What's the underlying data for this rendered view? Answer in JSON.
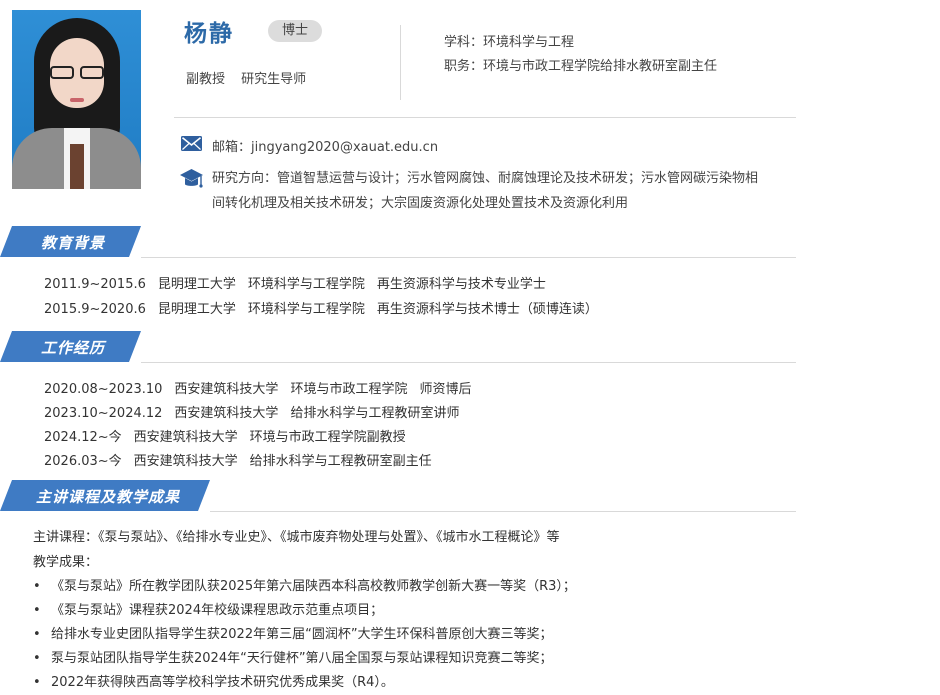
{
  "profile": {
    "name": "杨静",
    "degree": "博士",
    "titles": [
      "副教授",
      "研究生导师"
    ],
    "discipline": "学科：环境科学与工程",
    "position": "职务：环境与市政工程学院给排水教研室副主任",
    "email": "邮箱：jingyang2020@xauat.edu.cn",
    "research_line1": "研究方向：管道智慧运营与设计；污水管网腐蚀、耐腐蚀理论及技术研发；污水管网碳污染物相",
    "research_line2": "间转化机理及相关技术研发；大宗固废资源化处理处置技术及资源化利用"
  },
  "icons": {
    "mail": "mail-icon",
    "cap": "graduation-cap-icon"
  },
  "colors": {
    "accent": "#3f7bc4",
    "name": "#2d6aa8"
  },
  "education": {
    "title": "教育背景",
    "rows": [
      [
        "2011.9~2015.6",
        "昆明理工大学",
        "环境科学与工程学院",
        "再生资源科学与技术专业学士"
      ],
      [
        "2015.9~2020.6",
        "昆明理工大学",
        "环境科学与工程学院",
        "再生资源科学与技术博士（硕博连读）"
      ]
    ]
  },
  "work": {
    "title": "工作经历",
    "rows": [
      [
        "2020.08~2023.10",
        "西安建筑科技大学",
        "环境与市政工程学院",
        "师资博后"
      ],
      [
        "2023.10~2024.12",
        "西安建筑科技大学",
        "给排水科学与工程教研室讲师"
      ],
      [
        "2024.12~今",
        "西安建筑科技大学",
        "环境与市政工程学院副教授"
      ],
      [
        "2026.03~今",
        "西安建筑科技大学",
        "给排水科学与工程教研室副主任"
      ]
    ]
  },
  "teaching": {
    "title": "主讲课程及教学成果",
    "courses": "主讲课程：《泵与泵站》、《给排水专业史》、《城市废弃物处理与处置》、《城市水工程概论》等",
    "results_label": "教学成果：",
    "bullet_char": "•",
    "items": [
      "《泵与泵站》所在教学团队获2025年第六届陕西本科高校教师教学创新大赛一等奖（R3）；",
      "《泵与泵站》课程获2024年校级课程思政示范重点项目；",
      "给排水专业史团队指导学生获2022年第三届“圆润杯”大学生环保科普原创大赛三等奖；",
      "泵与泵站团队指导学生获2024年“天行健杯”第八届全国泵与泵站课程知识竞赛二等奖；",
      "2022年获得陕西高等学校科学技术研究优秀成果奖（R4）。"
    ]
  }
}
